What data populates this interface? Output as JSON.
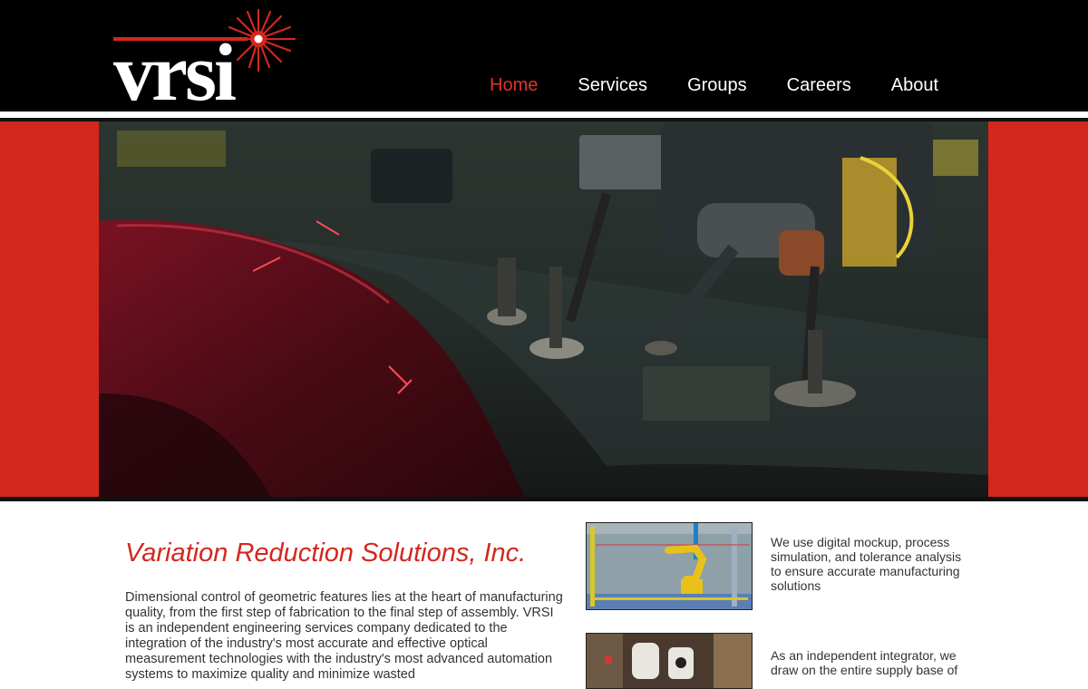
{
  "brand": {
    "logo_text": "vrsi"
  },
  "nav": {
    "items": [
      {
        "label": "Home",
        "active": true
      },
      {
        "label": "Services",
        "active": false
      },
      {
        "label": "Groups",
        "active": false
      },
      {
        "label": "Careers",
        "active": false
      },
      {
        "label": "About",
        "active": false
      }
    ]
  },
  "colors": {
    "accent": "#d3271f",
    "header_bg": "#000000",
    "text": "#333333"
  },
  "main": {
    "headline": "Variation Reduction Solutions, Inc.",
    "intro": "Dimensional control of geometric features lies at the heart of manufacturing quality, from the first step of fabrication to the final step of assembly.  VRSI is an independent engineering services company dedicated to the integration of the industry's most accurate and effective optical measurement technologies with the industry's most advanced automation systems to maximize quality and minimize wasted",
    "features": [
      {
        "text": "We use digital mockup, process simulation, and tolerance analysis to ensure accurate manufacturing solutions"
      },
      {
        "text": "As an independent integrator, we draw on the entire supply base of"
      }
    ]
  }
}
